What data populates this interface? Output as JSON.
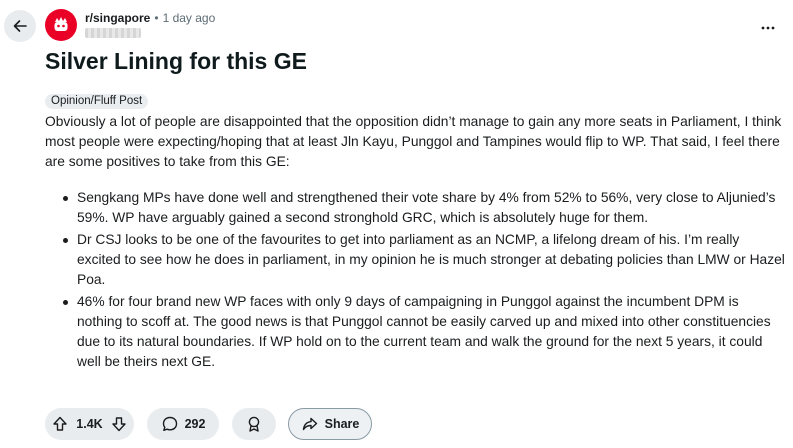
{
  "header": {
    "subreddit": "r/singapore",
    "separator": "•",
    "posted_time": "1 day ago"
  },
  "post": {
    "title": "Silver Lining for this GE",
    "flair": "Opinion/Fluff Post",
    "intro": "Obviously a lot of people are disappointed that the opposition didn’t manage to gain any more seats in Parliament, I think most people were expecting/hoping that at least Jln Kayu, Punggol and Tampines would flip to WP. That said, I feel there are some positives to take from this GE:",
    "bullets": [
      "Sengkang MPs have done well and strengthened their vote share by 4% from 52% to 56%, very close to Aljunied’s 59%. WP have arguably gained a second stronghold GRC, which is absolutely huge for them.",
      "Dr CSJ looks to be one of the favourites to get into parliament as an NCMP, a lifelong dream of his. I’m really excited to see how he does in parliament, in my opinion he is much stronger at debating policies than LMW or Hazel Poa.",
      "46% for four brand new WP faces with only 9 days of campaigning in Punggol against the incumbent DPM is nothing to scoff at. The good news is that Punggol cannot be easily carved up and mixed into other constituencies due to its natural boundaries. If WP hold on to the current team and walk the ground for the next 5 years, it could well be theirs next GE."
    ]
  },
  "actions": {
    "vote_count": "1.4K",
    "comment_count": "292",
    "share_label": "Share"
  },
  "icons": {
    "back": "arrow-left-icon",
    "avatar": "subreddit-avatar-icon",
    "overflow": "more-horizontal-icon",
    "upvote": "upvote-icon",
    "downvote": "downvote-icon",
    "comment": "comment-icon",
    "award": "award-icon",
    "share": "share-icon"
  },
  "colors": {
    "brand": "#ea0027",
    "pill_bg": "#e9ecee",
    "muted_text": "#5c6c74"
  }
}
